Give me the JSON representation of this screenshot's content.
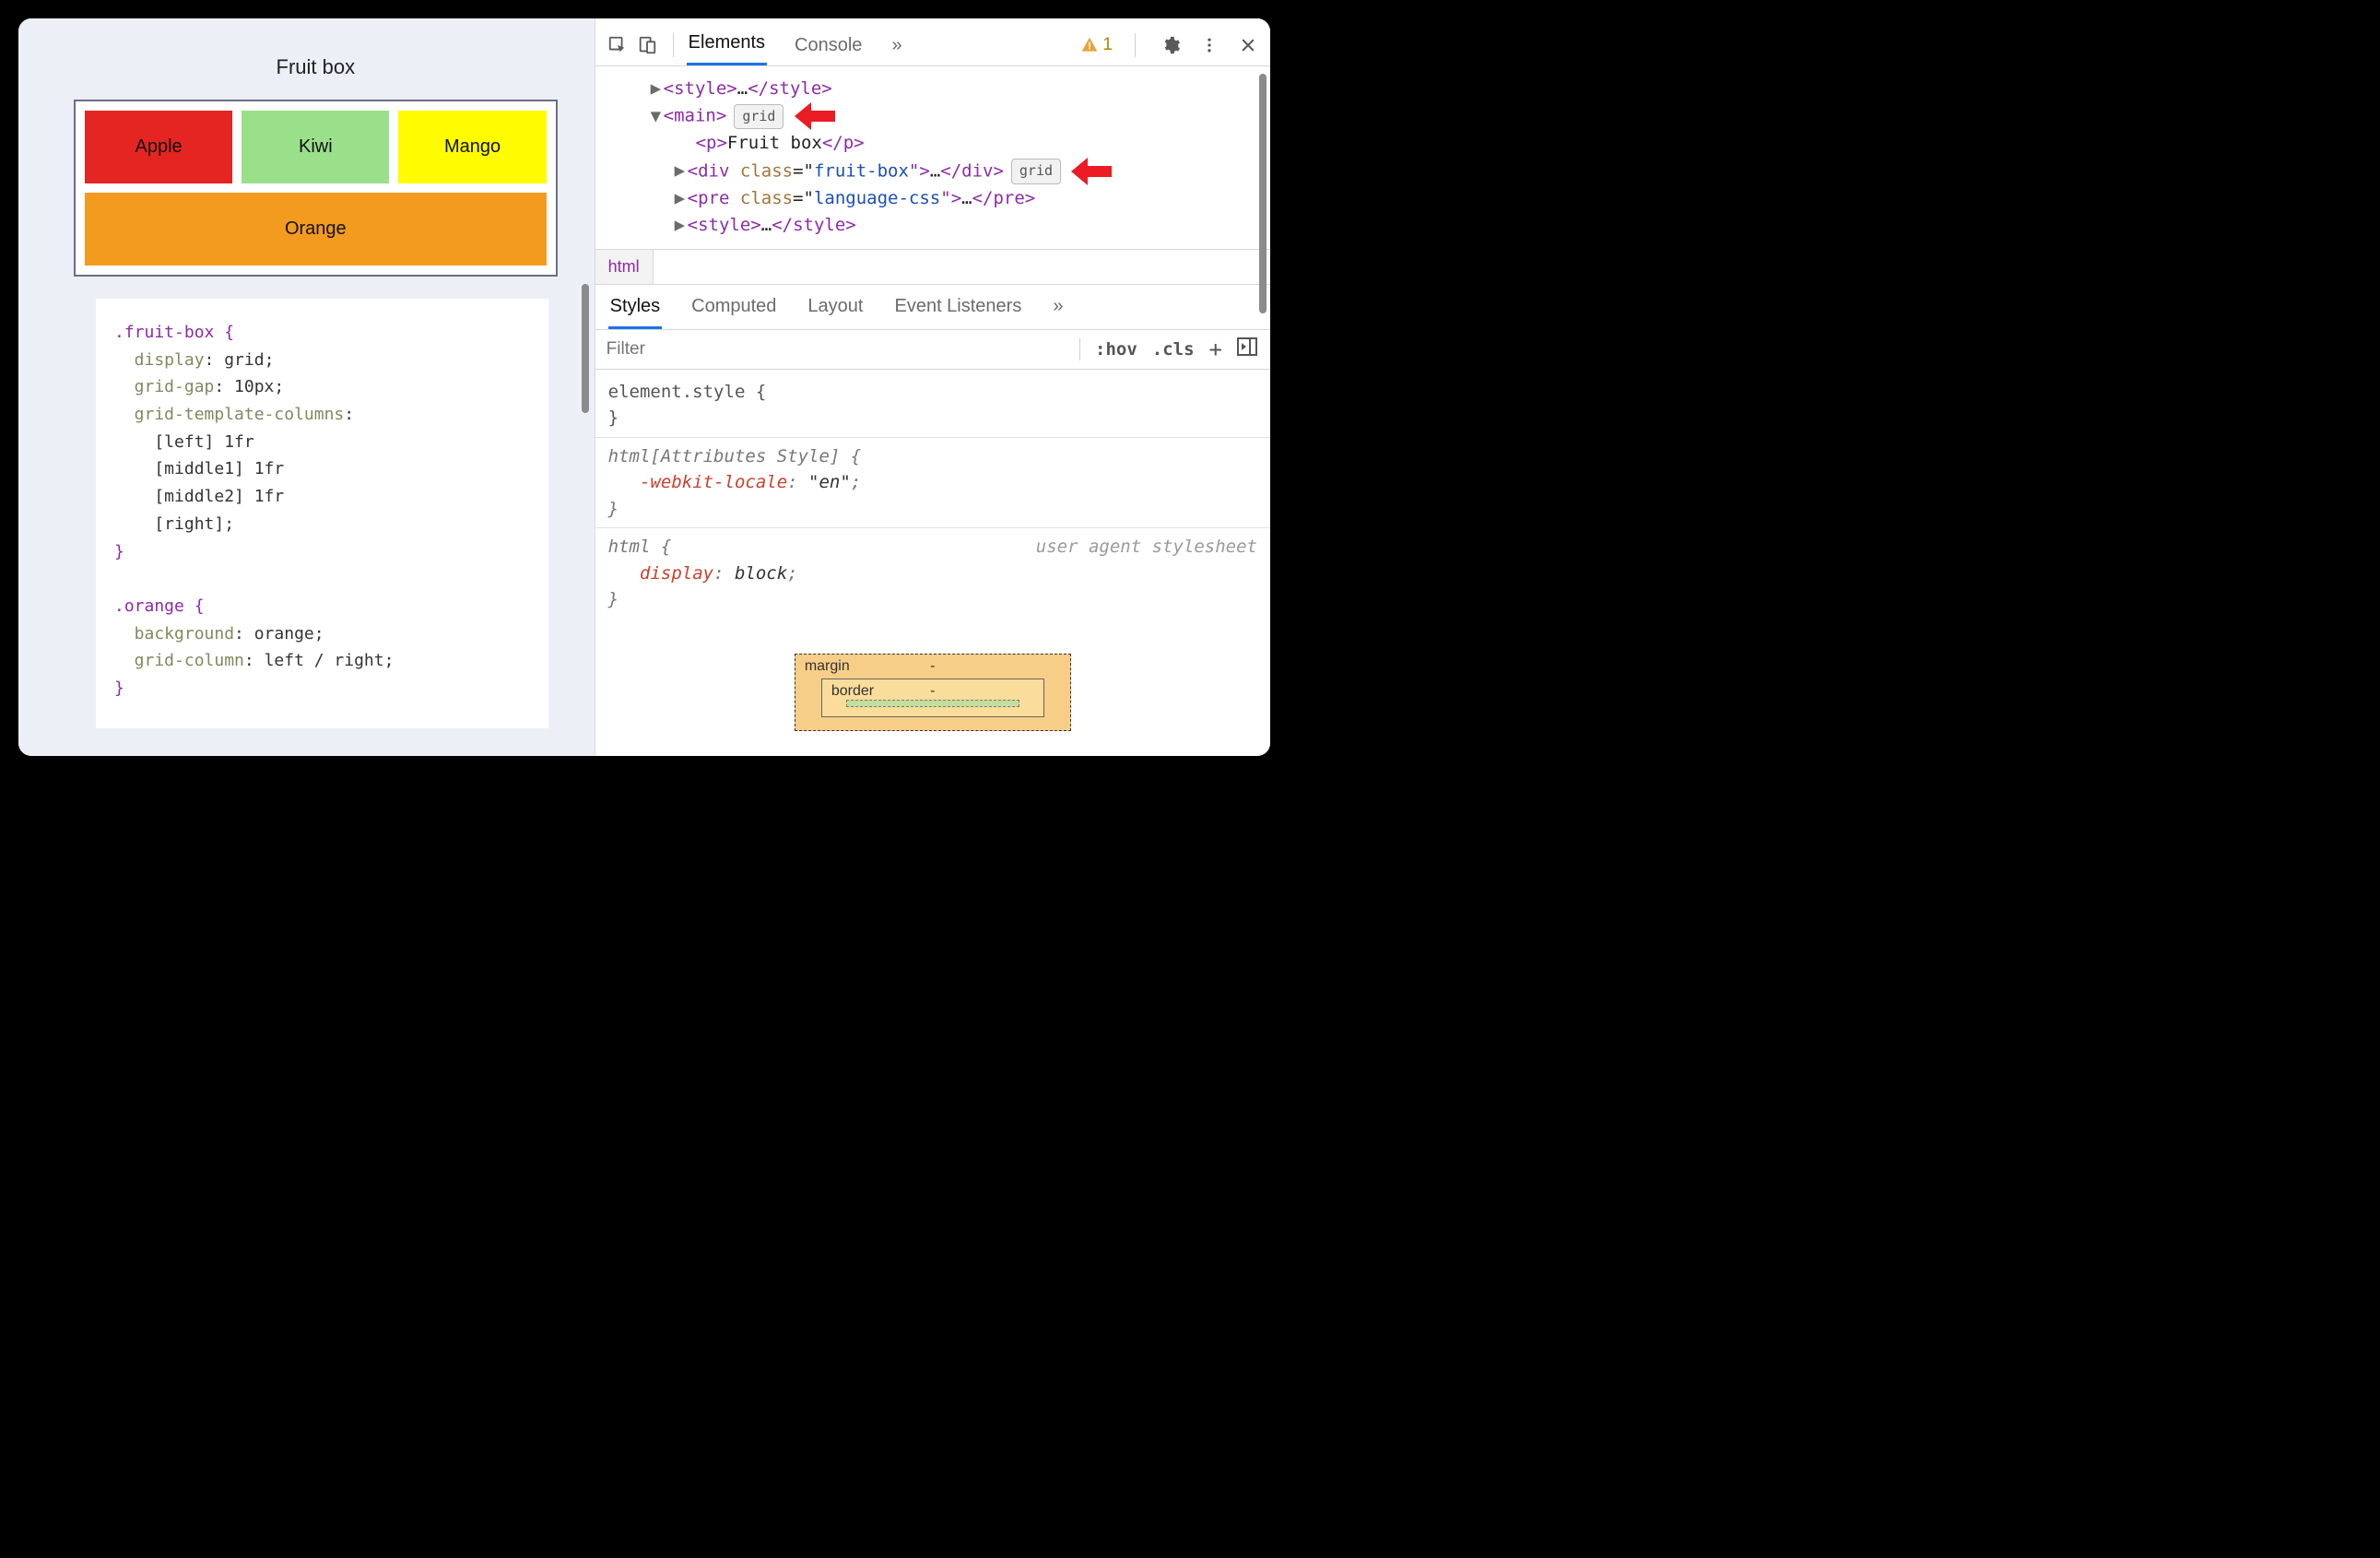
{
  "page": {
    "title": "Fruit box",
    "fruits": {
      "apple": "Apple",
      "kiwi": "Kiwi",
      "mango": "Mango",
      "orange": "Orange"
    },
    "css": {
      "l1": ".fruit-box {",
      "l2a": "  display",
      "l2b": ": grid;",
      "l3a": "  grid-gap",
      "l3b": ": 10px;",
      "l4a": "  grid-template-columns",
      "l4b": ":",
      "l5": "    [left] 1fr",
      "l6": "    [middle1] 1fr",
      "l7": "    [middle2] 1fr",
      "l8": "    [right];",
      "l9": "}",
      "l10": "",
      "l11": ".orange {",
      "l12a": "  background",
      "l12b": ": orange;",
      "l13a": "  grid-column",
      "l13b": ": left / right;",
      "l14": "}"
    }
  },
  "devtools": {
    "tabs": {
      "elements": "Elements",
      "console": "Console",
      "more": "»"
    },
    "warnings": "1",
    "dom": {
      "style1_open": "<style>",
      "style1_mid": "…",
      "style1_close": "</style>",
      "main_open": "<main>",
      "grid_badge": "grid",
      "p_open": "<p>",
      "p_text": "Fruit box",
      "p_close": "</p>",
      "div_open1": "<div ",
      "div_attrname": "class",
      "div_eq": "=\"",
      "div_attrval": "fruit-box",
      "div_open2": "\">",
      "div_mid": "…",
      "div_close": "</div>",
      "pre_open1": "<pre ",
      "pre_attrname": "class",
      "pre_attrval": "language-css",
      "pre_open2": "\">",
      "pre_mid": "…",
      "pre_close": "</pre>",
      "style2_open": "<style>",
      "style2_mid": "…",
      "style2_close": "</style>"
    },
    "breadcrumb": "html",
    "styles_tabs": {
      "styles": "Styles",
      "computed": "Computed",
      "layout": "Layout",
      "listeners": "Event Listeners",
      "more": "»"
    },
    "filter": {
      "placeholder": "Filter",
      "hov": ":hov",
      "cls": ".cls",
      "plus": "+"
    },
    "rules": {
      "r1a": "element.style {",
      "r1b": "}",
      "r2sel": "html[Attributes Style] {",
      "r2pa": "-webkit-locale",
      "r2pb": ": ",
      "r2pv": "\"en\"",
      "r2pc": ";",
      "r2end": "}",
      "r3sel": "html {",
      "r3src": "user agent stylesheet",
      "r3pa": "display",
      "r3pb": ": ",
      "r3pv": "block",
      "r3pc": ";",
      "r3end": "}"
    },
    "boxmodel": {
      "margin": "margin",
      "border": "border",
      "dash": "-"
    }
  }
}
